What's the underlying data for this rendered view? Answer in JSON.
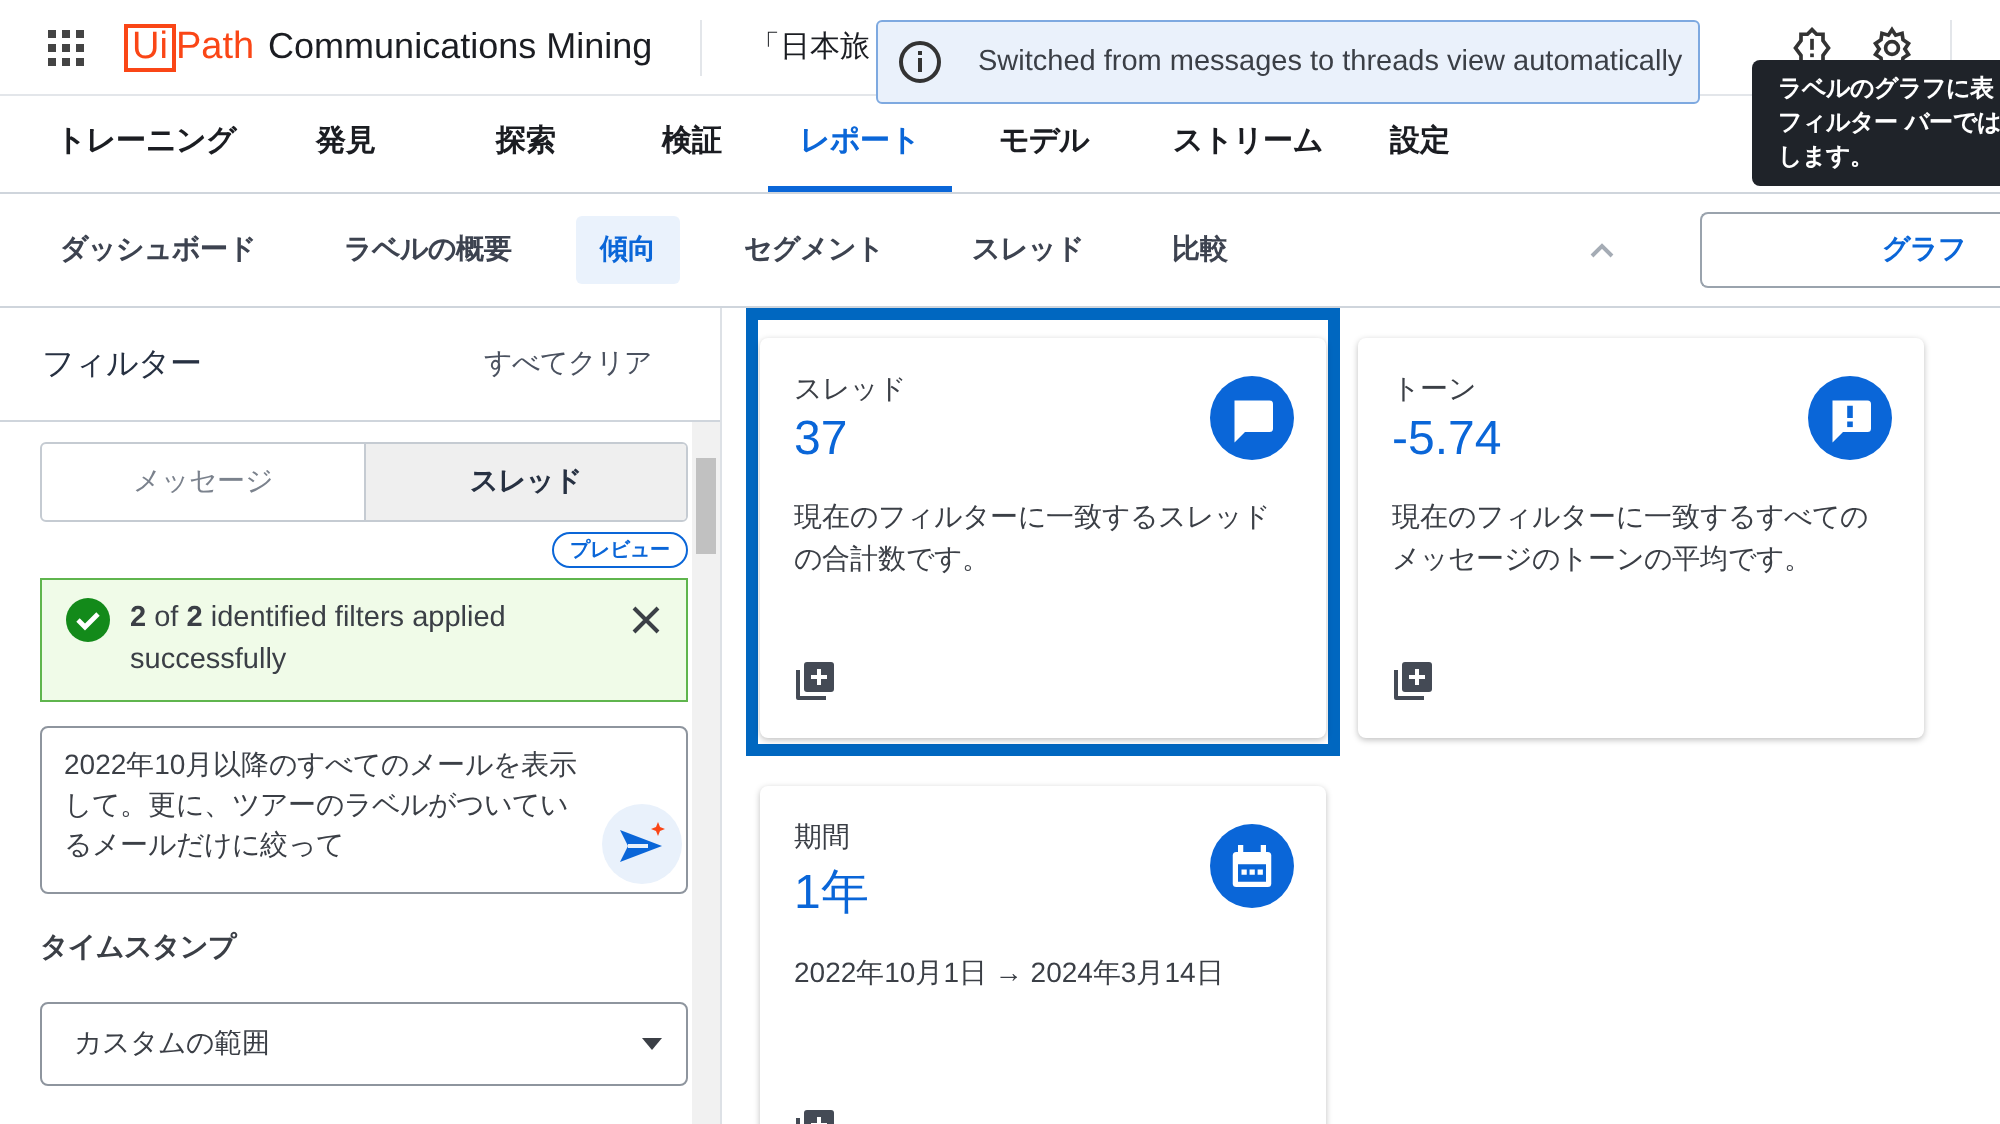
{
  "header": {
    "logo_box_text": "Ui",
    "logo_text": "Path",
    "app_name": "Communications Mining",
    "dataset_title": "「日本旅"
  },
  "toast": {
    "message": "Switched from messages to threads view automatically"
  },
  "tooltip": {
    "lines": [
      "ラベルのグラフに表",
      "フィルター バーでは",
      "します。"
    ]
  },
  "tabs": [
    {
      "label": "トレーニング",
      "selected": false
    },
    {
      "label": "発見",
      "selected": false
    },
    {
      "label": "探索",
      "selected": false
    },
    {
      "label": "検証",
      "selected": false
    },
    {
      "label": "レポート",
      "selected": true
    },
    {
      "label": "モデル",
      "selected": false
    },
    {
      "label": "ストリーム",
      "selected": false
    },
    {
      "label": "設定",
      "selected": false
    }
  ],
  "subtabs": [
    {
      "label": "ダッシュボード",
      "selected": false
    },
    {
      "label": "ラベルの概要",
      "selected": false
    },
    {
      "label": "傾向",
      "selected": true
    },
    {
      "label": "セグメント",
      "selected": false
    },
    {
      "label": "スレッド",
      "selected": false
    },
    {
      "label": "比較",
      "selected": false
    }
  ],
  "graph_button": {
    "label": "グラフ"
  },
  "filters": {
    "title": "フィルター",
    "clear_all": "すべてクリア",
    "view_toggle": [
      {
        "label": "メッセージ",
        "selected": false
      },
      {
        "label": "スレッド",
        "selected": true
      }
    ],
    "preview_badge": "プレビュー",
    "success_alert": {
      "text": "**2** of **2** identified filters applied successfully"
    },
    "query": {
      "value": "2022年10月以降のすべてのメールを表示して。更に、ツアーのラベルがついているメールだけに絞って"
    },
    "timestamp_label": "タイムスタンプ",
    "timestamp_select": {
      "value": "カスタムの範囲"
    }
  },
  "cards": [
    {
      "title": "スレッド",
      "value": "37",
      "description": [
        "現在のフィルターに一致するスレッド",
        "の合計数です。"
      ],
      "kind": "chat",
      "selected": true
    },
    {
      "title": "トーン",
      "value": "-5.74",
      "description": [
        "現在のフィルターに一致するすべての",
        "メッセージのトーンの平均です。"
      ],
      "kind": "alert",
      "selected": false
    },
    {
      "title": "期間",
      "value": "1年",
      "description": [
        "2022年10月1日 → 2024年3月14日"
      ],
      "kind": "calendar",
      "selected": false
    }
  ]
}
